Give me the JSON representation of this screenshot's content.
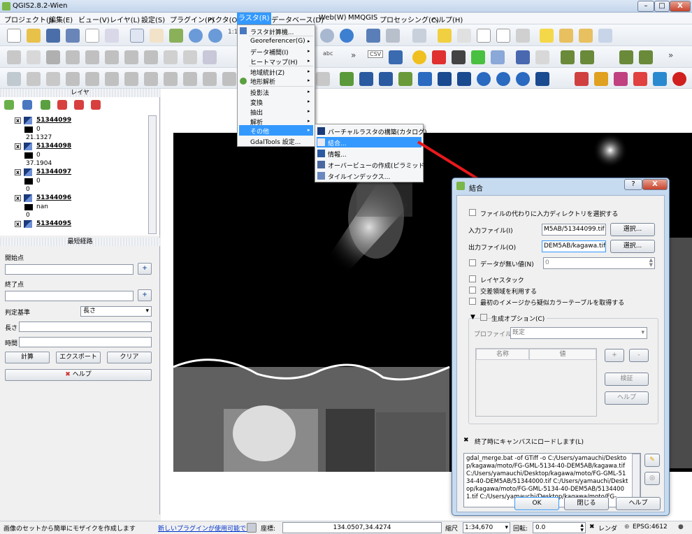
{
  "window": {
    "title": "QGIS2.8.2-Wien",
    "min": "–",
    "max": "□",
    "close": "X"
  },
  "menubar": [
    "プロジェクト(J)",
    "編集(E)",
    "ビュー(V)",
    "レイヤ(L)",
    "設定(S)",
    "プラグイン(P)",
    "ベクタ(O)",
    "ラスタ(R)",
    "データベース(D)",
    "Web(W)",
    "MMQGIS",
    "プロセッシング(C)",
    "ヘルプ(H)"
  ],
  "toolbar_text": {
    "zoom_label": "1:1",
    "csv": "CSV",
    "abc": "abc",
    "more": "»"
  },
  "layers_panel": {
    "title": "レイヤ",
    "layers": [
      {
        "name": "51344099",
        "v1": "0",
        "v2": "21.1327"
      },
      {
        "name": "51344098",
        "v1": "0",
        "v2": "37.1904"
      },
      {
        "name": "51344097",
        "v1": "0",
        "v2": "0"
      },
      {
        "name": "51344096",
        "v1": "nan",
        "v2": "0"
      },
      {
        "name": "51344095",
        "v1": "",
        "v2": ""
      }
    ]
  },
  "route_panel": {
    "title": "最短経路",
    "start_label": "開始点",
    "end_label": "終了点",
    "criterion_label": "判定基準",
    "criterion_value": "長さ",
    "length_label": "長さ",
    "time_label": "時間",
    "calc": "計算",
    "export": "エクスポート",
    "clear": "クリア",
    "help": "ヘルプ"
  },
  "raster_menu": {
    "items": [
      "ラスタ計算機...",
      "Georeferencer(G)",
      "データ補間(I)",
      "ヒートマップ(H)",
      "地域統計(Z)",
      "地形解析",
      "投影法",
      "変換",
      "抽出",
      "解析",
      "その他",
      "GdalTools 設定..."
    ]
  },
  "other_submenu": {
    "items": [
      "バーチャルラスタの構築(カタログ)...",
      "結合...",
      "情報...",
      "オーバービューの作成(ピラミッド)...",
      "タイルインデックス..."
    ]
  },
  "merge_dialog": {
    "title": "結合",
    "help_btn": "?",
    "close_btn": "X",
    "use_dir": "ファイルの代わりに入力ディレクトリを選択する",
    "input_label": "入力ファイル(I)",
    "input_value": "M5AB/51344099.tif",
    "output_label": "出力ファイル(O)",
    "output_value": "DEM5AB/kagawa.tif",
    "select": "選択...",
    "nodata_label": "データが無い値(N)",
    "nodata_value": "0",
    "layer_stack": "レイヤスタック",
    "use_intersect": "交差領域を利用する",
    "pct": "最初のイメージから疑似カラーテーブルを取得する",
    "creation_opts": "生成オプション(C)",
    "profile_label": "プロファイル",
    "profile_value": "既定",
    "col_name": "名称",
    "col_value": "値",
    "plus": "+",
    "minus": "-",
    "validate": "検証",
    "help": "ヘルプ",
    "load_canvas": "終了時にキャンバスにロードします(L)",
    "command": "gdal_merge.bat -of GTiff -o C:/Users/yamauchi/Desktop/kagawa/moto/FG-GML-5134-40-DEM5AB/kagawa.tif C:/Users/yamauchi/Desktop/kagawa/moto/FG-GML-5134-40-DEM5AB/51344000.tif C:/Users/yamauchi/Desktop/kagawa/moto/FG-GML-5134-40-DEM5AB/51344001.tif C:/Users/yamauchi/Desktop/kagawa/moto/FG-",
    "ok": "OK",
    "close": "閉じる",
    "help2": "ヘルプ"
  },
  "statusbar": {
    "message": "画像のセットから簡単にモザイクを作成します",
    "plugin_link": "新しいプラグインが使用可能です",
    "coord_label": "座標:",
    "coord_value": "134.0507,34.4274",
    "scale_label": "縮尺",
    "scale_value": "1:34,670",
    "rotation_label": "回転:",
    "rotation_value": "0.0",
    "render_label": "レンダ",
    "crs": "EPSG:4612"
  },
  "colors": {
    "accent": "#3399ff",
    "arrow": "#e8191c",
    "link": "#0033cc"
  }
}
